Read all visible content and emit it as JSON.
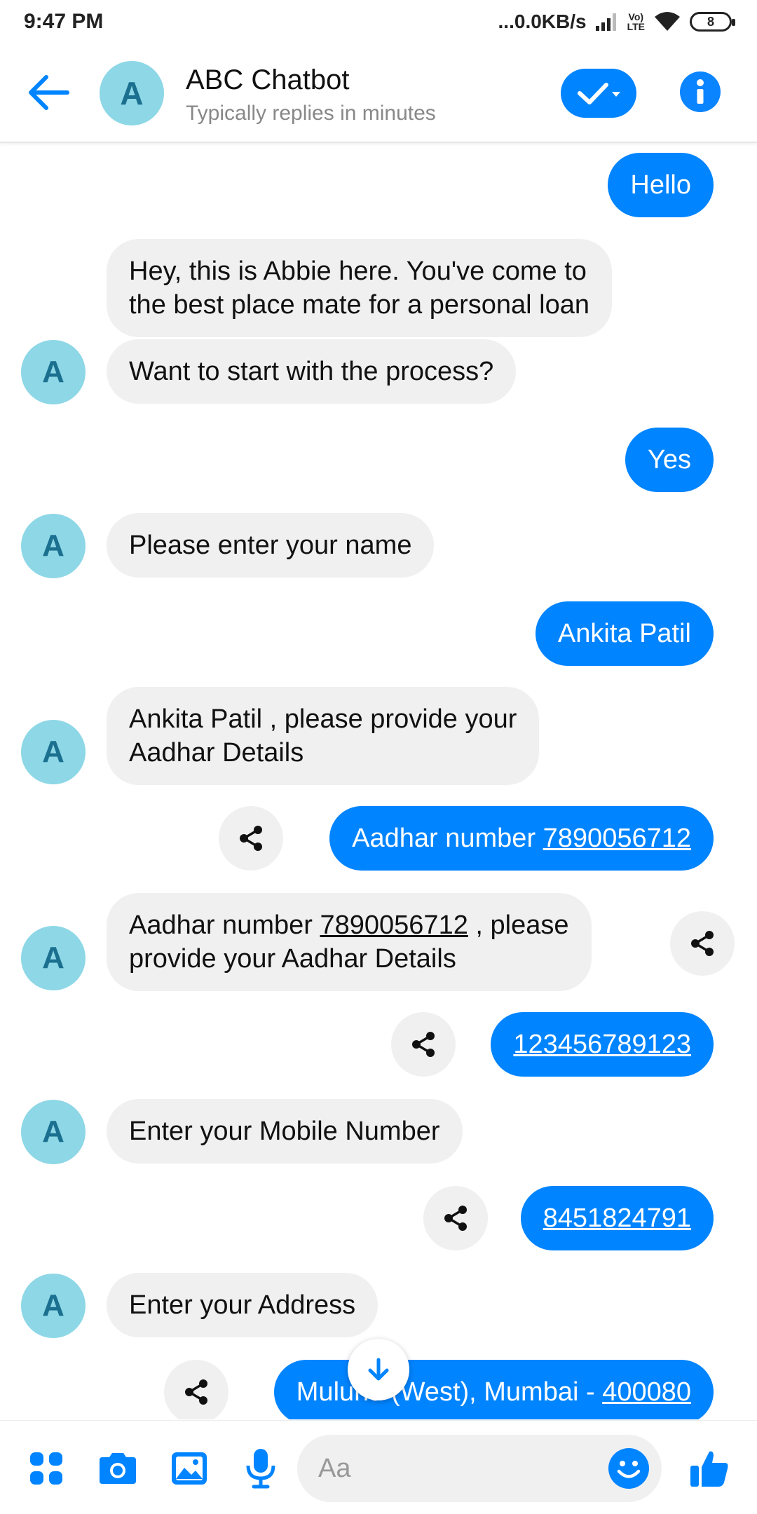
{
  "status": {
    "time": "9:47 PM",
    "speed": "...0.0KB/s",
    "volte_top": "Vo)",
    "volte_bottom": "LTE",
    "battery": "8"
  },
  "header": {
    "avatar_letter": "A",
    "title": "ABC Chatbot",
    "subtitle": "Typically replies in minutes"
  },
  "chat": {
    "avatar_letter": "A",
    "messages": [
      {
        "text": "Hello"
      },
      {
        "line1": "Hey, this is Abbie here. You've come to",
        "line2": "the best place mate for a personal loan"
      },
      {
        "text": "Want to start with the process?"
      },
      {
        "text": "Yes"
      },
      {
        "text": "Please enter your name"
      },
      {
        "text": "Ankita Patil"
      },
      {
        "line1": "Ankita Patil , please provide your",
        "line2": "Aadhar Details"
      },
      {
        "prefix": "Aadhar number ",
        "number": "7890056712"
      },
      {
        "prefix": "Aadhar number ",
        "number": "7890056712",
        "suffix": " , please",
        "line2": "provide your Aadhar Details"
      },
      {
        "number": "123456789123"
      },
      {
        "text": "Enter your Mobile Number"
      },
      {
        "number": "8451824791"
      },
      {
        "text": "Enter your Address"
      },
      {
        "prefix": "Mulund (West), Mumbai - ",
        "number": "400080"
      }
    ]
  },
  "composer": {
    "placeholder": "Aa"
  },
  "colors": {
    "accent": "#0084ff",
    "incoming_bubble": "#f0f0f0",
    "avatar_bg": "#8dd7e6"
  },
  "icons": [
    "back-arrow-icon",
    "check-icon",
    "info-icon",
    "share-icon",
    "arrow-down-icon",
    "apps-icon",
    "camera-icon",
    "gallery-icon",
    "microphone-icon",
    "emoji-icon",
    "thumbs-up-icon"
  ]
}
